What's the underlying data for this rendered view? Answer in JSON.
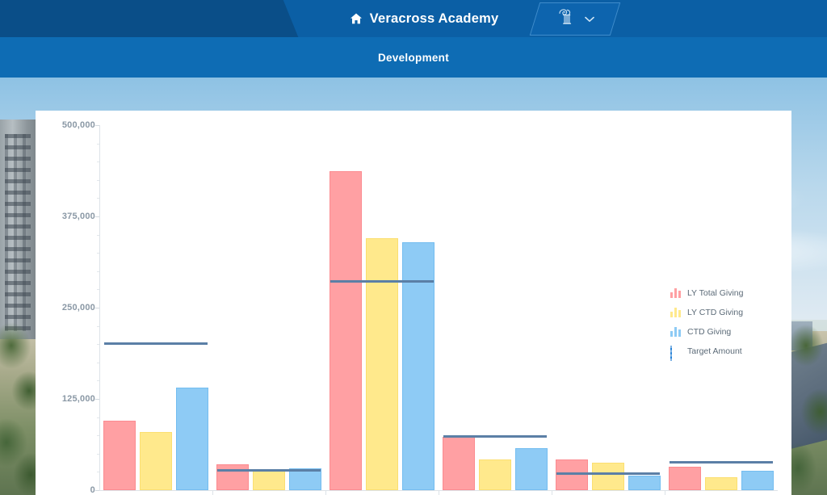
{
  "header": {
    "home_icon": "home-icon",
    "brand_title": "Veracross Academy",
    "school_logo_icon": "ionic-column-logo-icon",
    "dropdown_icon": "chevron-down-icon"
  },
  "subnav": {
    "active_label": "Development"
  },
  "chart_data": {
    "type": "bar",
    "title": "",
    "xlabel": "",
    "ylabel": "",
    "ylim": [
      0,
      500000
    ],
    "yticks": [
      0,
      125000,
      250000,
      375000,
      500000
    ],
    "ytick_labels": [
      "0",
      "125,000",
      "250,000",
      "375,000",
      "500,000"
    ],
    "grid": false,
    "legend_position": "right",
    "categories": [
      "",
      "",
      "",
      "",
      "",
      ""
    ],
    "series": [
      {
        "name": "LY Total Giving",
        "color": "#ffa0a3",
        "values": [
          95000,
          35000,
          437000,
          73000,
          42000,
          32000
        ]
      },
      {
        "name": "LY CTD Giving",
        "color": "#ffe98c",
        "values": [
          80000,
          28000,
          345000,
          42000,
          38000,
          18000
        ]
      },
      {
        "name": "CTD Giving",
        "color": "#8ecbf5",
        "values": [
          140000,
          30000,
          340000,
          58000,
          20000,
          27000
        ]
      },
      {
        "name": "Target Amount",
        "color": "#2281d8",
        "values": [
          200000,
          27000,
          285000,
          73000,
          22000,
          38000
        ],
        "render": "line-marker"
      }
    ]
  },
  "legend": {
    "items": [
      {
        "label": "LY Total Giving",
        "icon": "bar-chart-icon",
        "color": "#ffa0a3"
      },
      {
        "label": "LY CTD Giving",
        "icon": "bar-chart-icon",
        "color": "#ffe98c"
      },
      {
        "label": "CTD Giving",
        "icon": "bar-chart-icon",
        "color": "#8ecbf5"
      },
      {
        "label": "Target Amount",
        "icon": "square-swatch-icon",
        "color": "#2281d8"
      }
    ]
  }
}
